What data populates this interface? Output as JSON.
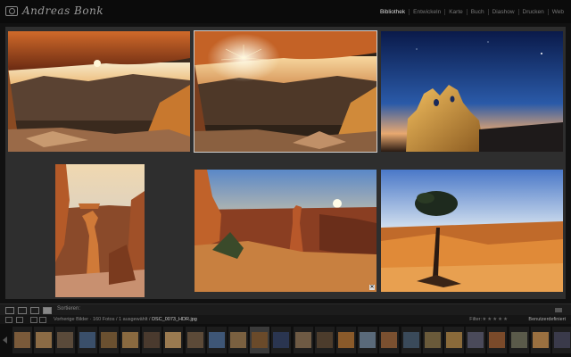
{
  "app": {
    "author_logo": "Andreas Bonk"
  },
  "modules": [
    "Bibliothek",
    "Entwickeln",
    "Karte",
    "Buch",
    "Diashow",
    "Drucken",
    "Web"
  ],
  "active_module": "Bibliothek",
  "grid": {
    "photos": [
      {
        "name": "photo-mesa-arch-sunrise",
        "selected": false
      },
      {
        "name": "photo-mesa-arch-sunburst",
        "selected": true
      },
      {
        "name": "photo-hoodoo-night-sky",
        "selected": false
      },
      {
        "name": "photo-thors-hammer",
        "selected": false
      },
      {
        "name": "photo-bryce-canyon-sunrise",
        "selected": false,
        "badge": true
      },
      {
        "name": "photo-lone-pine-bryce",
        "selected": false
      }
    ]
  },
  "toolbar": {
    "sort_label": "Sortieren:"
  },
  "filmstrip_bar": {
    "source_info": "Vorherige Bilder · 160 Fotos / 1 ausgewählt /",
    "filename": "DSC_0073_HDR.jpg",
    "filter_label": "Filter:",
    "filter_set": "Benutzerdefiniert"
  },
  "filmstrip": {
    "thumb_colors": [
      "#7a5a3a",
      "#8b6b45",
      "#5a4a3a",
      "#3a4f6a",
      "#6a5030",
      "#8a6a40",
      "#4a3a2e",
      "#9a7a50",
      "#5c4a38",
      "#3e5676",
      "#7a6040",
      "#6a4a2a",
      "#2a3550",
      "#6e5a44",
      "#4c3c2c",
      "#8a5a2a",
      "#5a6a7a",
      "#7a5030",
      "#3a4a5a",
      "#6a5a3a",
      "#8a6a3a",
      "#4a4a5a",
      "#7a4a2a",
      "#5a5a4a",
      "#9a7040",
      "#3a3a4a"
    ],
    "selected_index": 11
  }
}
